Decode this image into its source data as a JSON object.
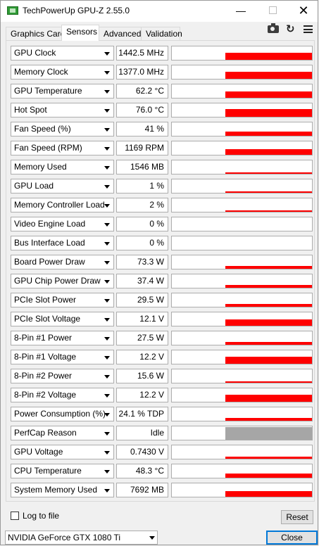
{
  "window": {
    "title": "TechPowerUp GPU-Z 2.55.0"
  },
  "tabs": [
    {
      "label": "Graphics Card",
      "active": false
    },
    {
      "label": "Sensors",
      "active": true
    },
    {
      "label": "Advanced",
      "active": false
    },
    {
      "label": "Validation",
      "active": false
    }
  ],
  "toolbar": {
    "screenshot_icon": "camera-icon",
    "refresh_icon": "refresh-icon",
    "menu_icon": "menu-icon"
  },
  "sensors": [
    {
      "name": "GPU Clock",
      "value": "1442.5 MHz",
      "graph_level": 0.55,
      "graph_color": "red"
    },
    {
      "name": "Memory Clock",
      "value": "1377.0 MHz",
      "graph_level": 0.55,
      "graph_color": "red"
    },
    {
      "name": "GPU Temperature",
      "value": "62.2 °C",
      "graph_level": 0.45,
      "graph_color": "red"
    },
    {
      "name": "Hot Spot",
      "value": "76.0 °C",
      "graph_level": 0.6,
      "graph_color": "red"
    },
    {
      "name": "Fan Speed (%)",
      "value": "41 %",
      "graph_level": 0.3,
      "graph_color": "red"
    },
    {
      "name": "Fan Speed (RPM)",
      "value": "1169 RPM",
      "graph_level": 0.4,
      "graph_color": "red"
    },
    {
      "name": "Memory Used",
      "value": "1546 MB",
      "graph_level": 0.08,
      "graph_color": "red"
    },
    {
      "name": "GPU Load",
      "value": "1 %",
      "graph_level": 0.1,
      "graph_color": "red"
    },
    {
      "name": "Memory Controller Load",
      "value": "2 %",
      "graph_level": 0.1,
      "graph_color": "red"
    },
    {
      "name": "Video Engine Load",
      "value": "0 %",
      "graph_level": 0.0,
      "graph_color": "red"
    },
    {
      "name": "Bus Interface Load",
      "value": "0 %",
      "graph_level": 0.0,
      "graph_color": "red"
    },
    {
      "name": "Board Power Draw",
      "value": "73.3 W",
      "graph_level": 0.2,
      "graph_color": "red"
    },
    {
      "name": "GPU Chip Power Draw",
      "value": "37.4 W",
      "graph_level": 0.2,
      "graph_color": "red"
    },
    {
      "name": "PCIe Slot Power",
      "value": "29.5 W",
      "graph_level": 0.2,
      "graph_color": "red"
    },
    {
      "name": "PCIe Slot Voltage",
      "value": "12.1 V",
      "graph_level": 0.45,
      "graph_color": "red"
    },
    {
      "name": "8-Pin #1 Power",
      "value": "27.5 W",
      "graph_level": 0.2,
      "graph_color": "red"
    },
    {
      "name": "8-Pin #1 Voltage",
      "value": "12.2 V",
      "graph_level": 0.5,
      "graph_color": "red"
    },
    {
      "name": "8-Pin #2 Power",
      "value": "15.6 W",
      "graph_level": 0.1,
      "graph_color": "red"
    },
    {
      "name": "8-Pin #2 Voltage",
      "value": "12.2 V",
      "graph_level": 0.55,
      "graph_color": "red"
    },
    {
      "name": "Power Consumption (%)",
      "value": "24.1 % TDP",
      "graph_level": 0.2,
      "graph_color": "red"
    },
    {
      "name": "PerfCap Reason",
      "value": "Idle",
      "graph_level": 0.95,
      "graph_color": "gray"
    },
    {
      "name": "GPU Voltage",
      "value": "0.7430 V",
      "graph_level": 0.15,
      "graph_color": "red"
    },
    {
      "name": "CPU Temperature",
      "value": "48.3 °C",
      "graph_level": 0.3,
      "graph_color": "red"
    },
    {
      "name": "System Memory Used",
      "value": "7692 MB",
      "graph_level": 0.4,
      "graph_color": "red"
    }
  ],
  "footer": {
    "log_to_file_label": "Log to file",
    "log_to_file_checked": false,
    "reset_label": "Reset",
    "gpu_selected": "NVIDIA GeForce GTX 1080 Ti",
    "close_label": "Close"
  },
  "colors": {
    "graph_red": "#ff0000",
    "graph_gray": "#a6a6a6",
    "close_border": "#0078d7"
  }
}
